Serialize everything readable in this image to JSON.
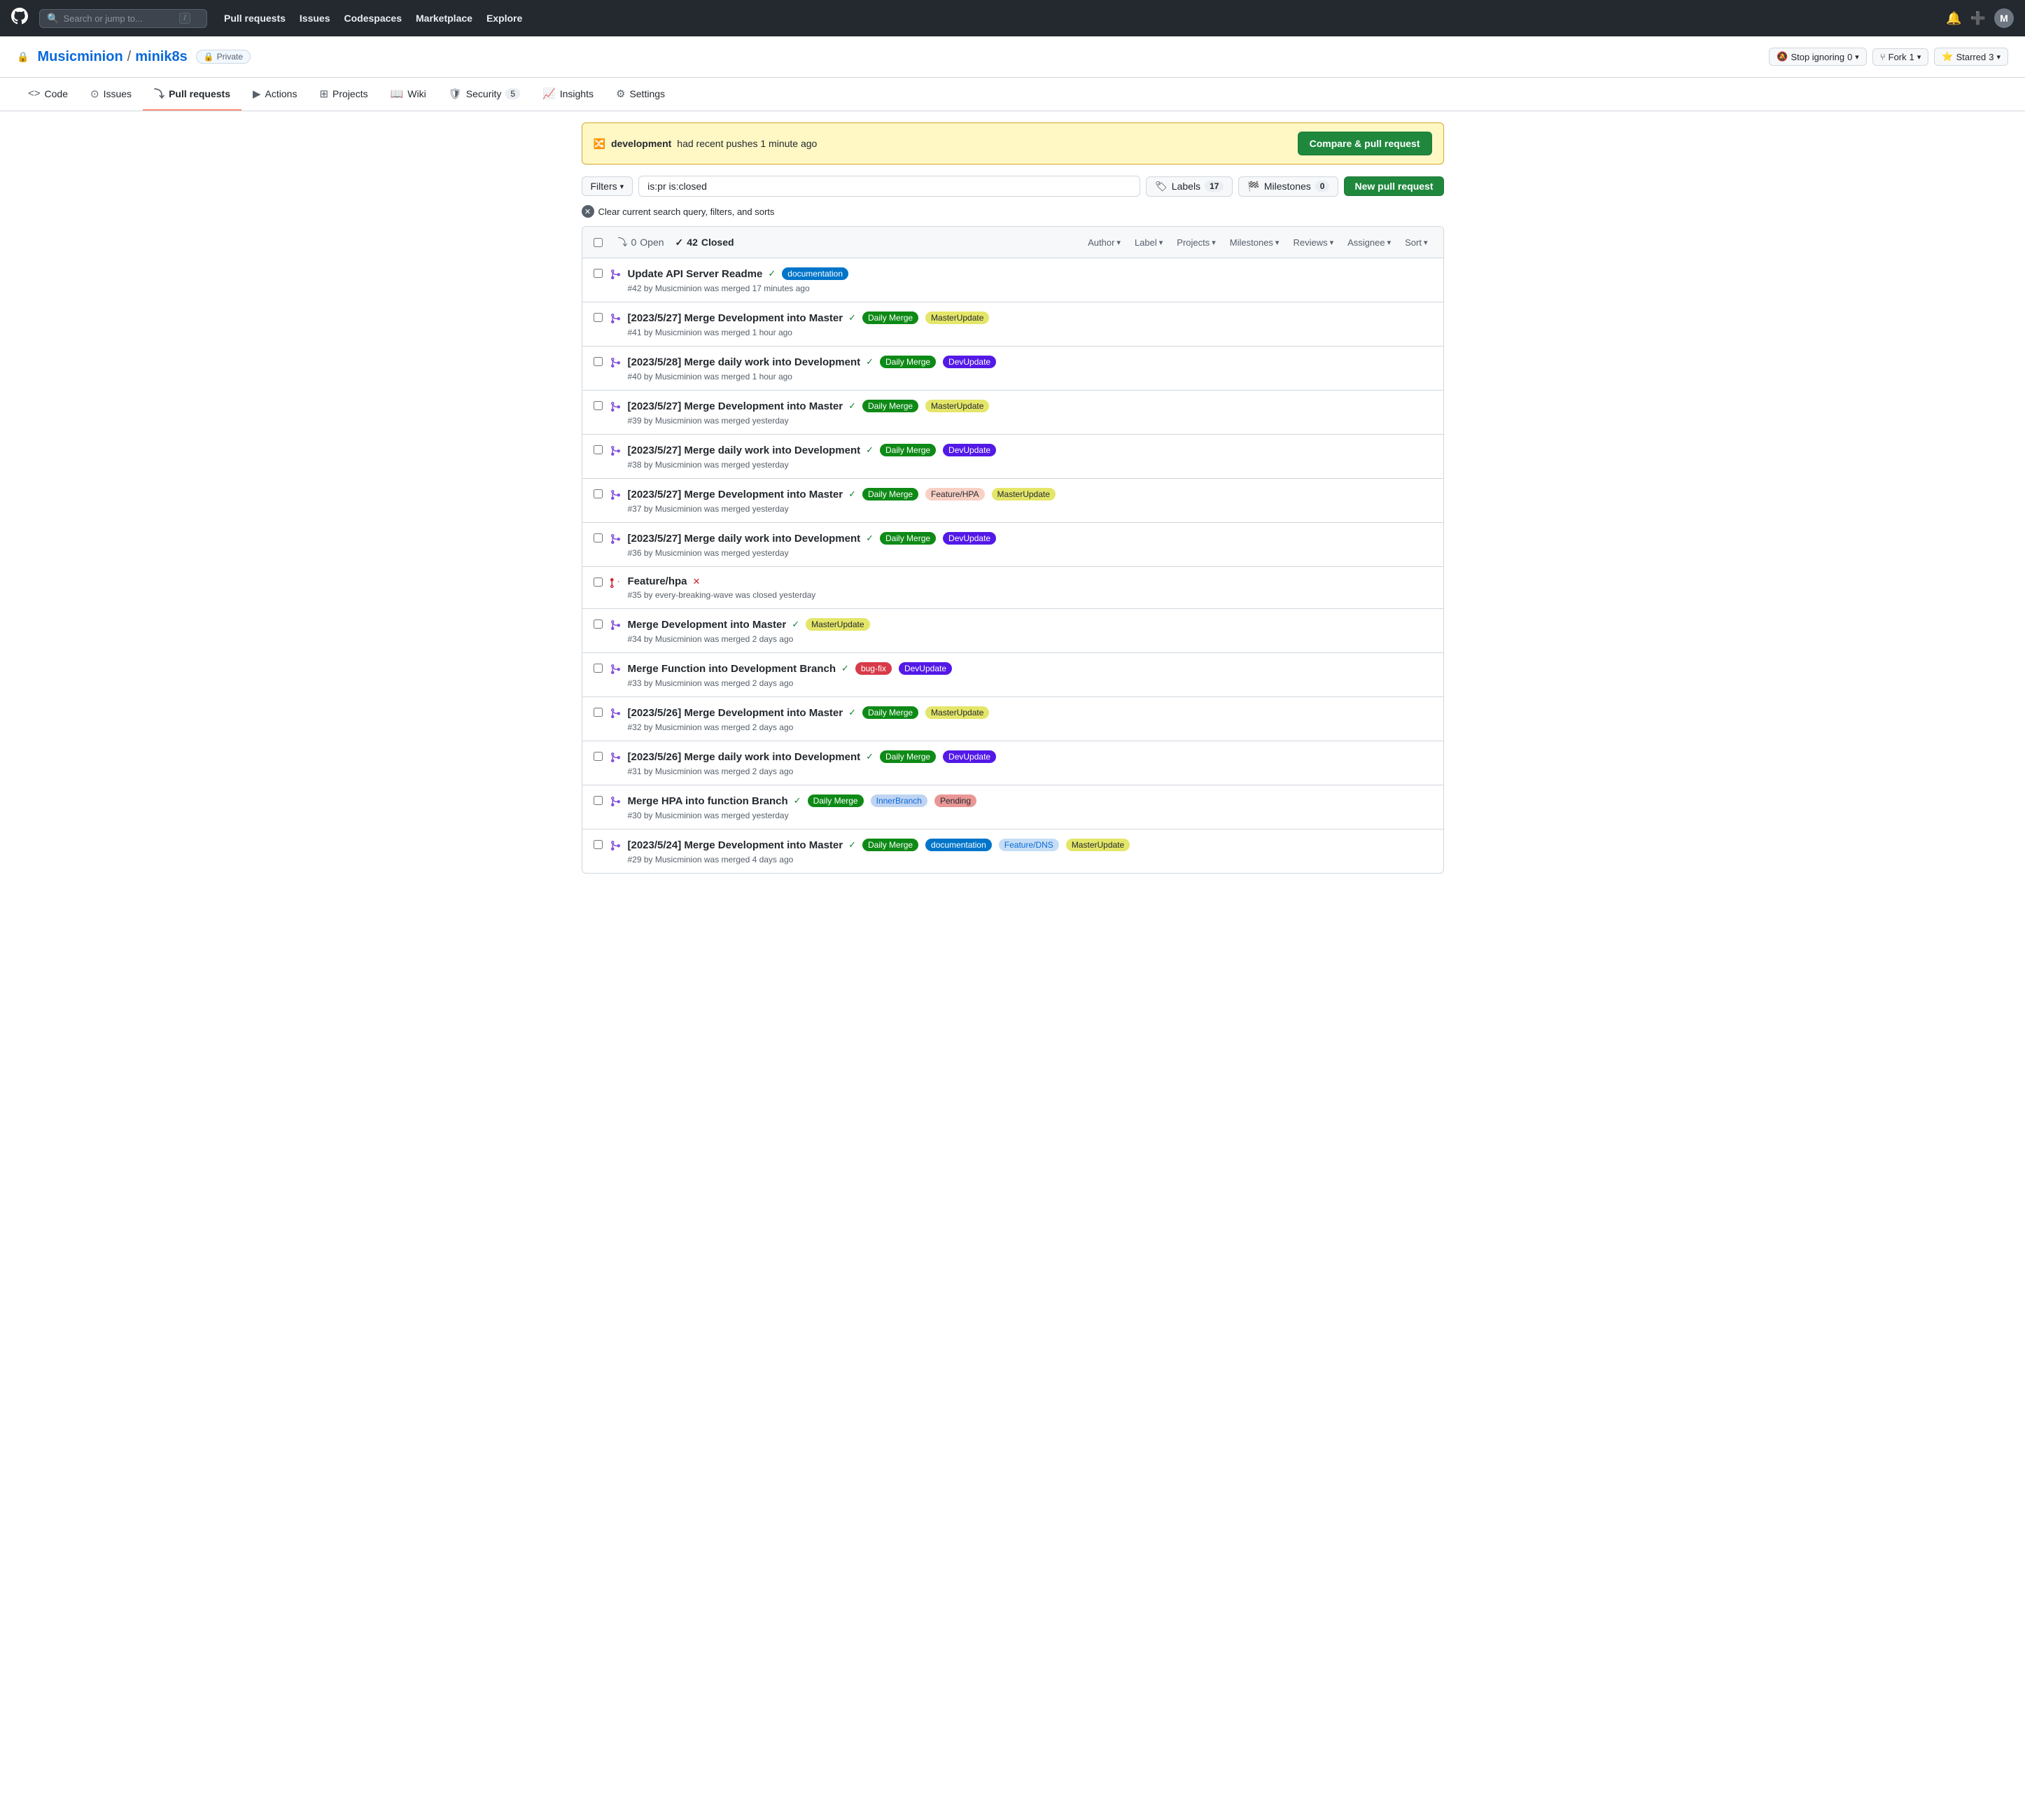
{
  "topnav": {
    "search_placeholder": "Search or jump to...",
    "slash_key": "/",
    "links": [
      "Pull requests",
      "Issues",
      "Codespaces",
      "Marketplace",
      "Explore"
    ]
  },
  "repo": {
    "org": "Musicminion",
    "repo": "minik8s",
    "visibility": "Private",
    "stop_ignoring_label": "Stop ignoring",
    "stop_ignoring_count": "0",
    "fork_label": "Fork",
    "fork_count": "1",
    "star_label": "Starred",
    "star_count": "3"
  },
  "tabs": [
    {
      "label": "Code",
      "icon": "code-icon",
      "active": false
    },
    {
      "label": "Issues",
      "icon": "issues-icon",
      "active": false
    },
    {
      "label": "Pull requests",
      "icon": "pr-icon",
      "active": true
    },
    {
      "label": "Actions",
      "icon": "actions-icon",
      "active": false
    },
    {
      "label": "Projects",
      "icon": "projects-icon",
      "active": false
    },
    {
      "label": "Wiki",
      "icon": "wiki-icon",
      "active": false
    },
    {
      "label": "Security",
      "icon": "security-icon",
      "active": false,
      "count": "5"
    },
    {
      "label": "Insights",
      "icon": "insights-icon",
      "active": false
    },
    {
      "label": "Settings",
      "icon": "settings-icon",
      "active": false
    }
  ],
  "banner": {
    "text_prefix": "development",
    "text_suffix": "had recent pushes 1 minute ago",
    "button_label": "Compare & pull request"
  },
  "filters": {
    "filter_label": "Filters",
    "search_value": "is:pr is:closed",
    "labels_label": "Labels",
    "labels_count": "17",
    "milestones_label": "Milestones",
    "milestones_count": "0",
    "new_pr_label": "New pull request",
    "clear_label": "Clear current search query, filters, and sorts"
  },
  "pr_header": {
    "open_count": "0",
    "closed_count": "42",
    "open_label": "Open",
    "closed_label": "Closed",
    "author_label": "Author",
    "label_label": "Label",
    "projects_label": "Projects",
    "milestones_label": "Milestones",
    "reviews_label": "Reviews",
    "assignee_label": "Assignee",
    "sort_label": "Sort"
  },
  "pull_requests": [
    {
      "number": "#42",
      "title": "Update API Server Readme",
      "status": "merged",
      "check": "green",
      "labels": [
        {
          "name": "documentation",
          "class": "label-documentation",
          "text": "documentation"
        }
      ],
      "meta": "#42 by Musicminion was merged 17 minutes ago"
    },
    {
      "number": "#41",
      "title": "[2023/5/27] Merge Development into Master",
      "status": "merged",
      "check": "green",
      "labels": [
        {
          "name": "daily-merge",
          "class": "label-daily-merge",
          "text": "Daily Merge"
        },
        {
          "name": "master-update",
          "class": "label-master-update",
          "text": "MasterUpdate"
        }
      ],
      "meta": "#41 by Musicminion was merged 1 hour ago"
    },
    {
      "number": "#40",
      "title": "[2023/5/28] Merge daily work into Development",
      "status": "merged",
      "check": "green",
      "labels": [
        {
          "name": "daily-merge",
          "class": "label-daily-merge",
          "text": "Daily Merge"
        },
        {
          "name": "dev-update",
          "class": "label-dev-update",
          "text": "DevUpdate"
        }
      ],
      "meta": "#40 by Musicminion was merged 1 hour ago"
    },
    {
      "number": "#39",
      "title": "[2023/5/27] Merge Development into Master",
      "status": "merged",
      "check": "green",
      "labels": [
        {
          "name": "daily-merge",
          "class": "label-daily-merge",
          "text": "Daily Merge"
        },
        {
          "name": "master-update",
          "class": "label-master-update",
          "text": "MasterUpdate"
        }
      ],
      "meta": "#39 by Musicminion was merged yesterday"
    },
    {
      "number": "#38",
      "title": "[2023/5/27] Merge daily work into Development",
      "status": "merged",
      "check": "green",
      "labels": [
        {
          "name": "daily-merge",
          "class": "label-daily-merge",
          "text": "Daily Merge"
        },
        {
          "name": "dev-update",
          "class": "label-dev-update",
          "text": "DevUpdate"
        }
      ],
      "meta": "#38 by Musicminion was merged yesterday"
    },
    {
      "number": "#37",
      "title": "[2023/5/27] Merge Development into Master",
      "status": "merged",
      "check": "green",
      "labels": [
        {
          "name": "daily-merge",
          "class": "label-daily-merge",
          "text": "Daily Merge"
        },
        {
          "name": "feature-hpa",
          "class": "label-feature-hpa",
          "text": "Feature/HPA"
        },
        {
          "name": "master-update",
          "class": "label-master-update",
          "text": "MasterUpdate"
        }
      ],
      "meta": "#37 by Musicminion was merged yesterday"
    },
    {
      "number": "#36",
      "title": "[2023/5/27] Merge daily work into Development",
      "status": "merged",
      "check": "green",
      "labels": [
        {
          "name": "daily-merge",
          "class": "label-daily-merge",
          "text": "Daily Merge"
        },
        {
          "name": "dev-update",
          "class": "label-dev-update",
          "text": "DevUpdate"
        }
      ],
      "meta": "#36 by Musicminion was merged yesterday"
    },
    {
      "number": "#35",
      "title": "Feature/hpa",
      "status": "closed",
      "check": "red",
      "labels": [],
      "meta": "#35 by every-breaking-wave was closed yesterday"
    },
    {
      "number": "#34",
      "title": "Merge Development into Master",
      "status": "merged",
      "check": "green",
      "labels": [
        {
          "name": "master-update",
          "class": "label-master-update",
          "text": "MasterUpdate"
        }
      ],
      "meta": "#34 by Musicminion was merged 2 days ago"
    },
    {
      "number": "#33",
      "title": "Merge Function into Development Branch",
      "status": "merged",
      "check": "green",
      "labels": [
        {
          "name": "bug-fix",
          "class": "label-bug-fix",
          "text": "bug-fix"
        },
        {
          "name": "dev-update",
          "class": "label-dev-update",
          "text": "DevUpdate"
        }
      ],
      "meta": "#33 by Musicminion was merged 2 days ago"
    },
    {
      "number": "#32",
      "title": "[2023/5/26] Merge Development into Master",
      "status": "merged",
      "check": "green",
      "labels": [
        {
          "name": "daily-merge",
          "class": "label-daily-merge",
          "text": "Daily Merge"
        },
        {
          "name": "master-update",
          "class": "label-master-update",
          "text": "MasterUpdate"
        }
      ],
      "meta": "#32 by Musicminion was merged 2 days ago"
    },
    {
      "number": "#31",
      "title": "[2023/5/26] Merge daily work into Development",
      "status": "merged",
      "check": "green",
      "labels": [
        {
          "name": "daily-merge",
          "class": "label-daily-merge",
          "text": "Daily Merge"
        },
        {
          "name": "dev-update",
          "class": "label-dev-update",
          "text": "DevUpdate"
        }
      ],
      "meta": "#31 by Musicminion was merged 2 days ago"
    },
    {
      "number": "#30",
      "title": "Merge HPA into function Branch",
      "status": "merged",
      "check": "green",
      "labels": [
        {
          "name": "daily-merge",
          "class": "label-daily-merge",
          "text": "Daily Merge"
        },
        {
          "name": "inner-branch",
          "class": "label-inner-branch",
          "text": "InnerBranch"
        },
        {
          "name": "pending",
          "class": "label-pending",
          "text": "Pending"
        }
      ],
      "meta": "#30 by Musicminion was merged yesterday"
    },
    {
      "number": "#29",
      "title": "[2023/5/24] Merge Development into Master",
      "status": "merged",
      "check": "green",
      "labels": [
        {
          "name": "daily-merge",
          "class": "label-daily-merge",
          "text": "Daily Merge"
        },
        {
          "name": "documentation",
          "class": "label-documentation",
          "text": "documentation"
        },
        {
          "name": "feature-dns",
          "class": "label-feature-dns",
          "text": "Feature/DNS"
        },
        {
          "name": "master-update",
          "class": "label-master-update",
          "text": "MasterUpdate"
        }
      ],
      "meta": "#29 by Musicminion was merged 4 days ago"
    }
  ]
}
